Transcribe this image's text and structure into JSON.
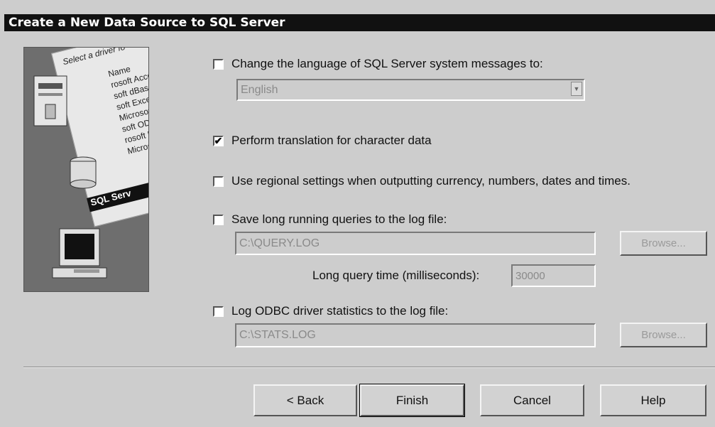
{
  "window": {
    "title": "Create a New Data Source to SQL Server"
  },
  "art": {
    "caption": "Select a driver fo",
    "list": [
      "Name",
      "rosoft Access D",
      "soft dBase D",
      "soft Excel D",
      "Microsoft FoxPr",
      "soft ODBC",
      "rosoft Para",
      "Microsoft Tex"
    ],
    "selected": "SQL Serv"
  },
  "options": {
    "language": {
      "checked": false,
      "mark": "",
      "label": "Change the language of SQL Server system messages to:",
      "value": "English"
    },
    "translation": {
      "checked": true,
      "mark": "✔",
      "label": "Perform translation for character data"
    },
    "regional": {
      "checked": false,
      "mark": "",
      "label": "Use regional settings when outputting currency, numbers, dates and times."
    },
    "long_queries": {
      "checked": false,
      "mark": "",
      "label": "Save long running queries to the log file:",
      "file": "C:\\QUERY.LOG",
      "browse_label": "Browse...",
      "time_label": "Long query time (milliseconds):",
      "time_value": "30000"
    },
    "stats": {
      "checked": false,
      "mark": "",
      "label": "Log ODBC driver statistics to the log file:",
      "file": "C:\\STATS.LOG",
      "browse_label": "Browse..."
    }
  },
  "buttons": {
    "back": "< Back",
    "finish": "Finish",
    "cancel": "Cancel",
    "help": "Help"
  },
  "icons": {
    "dropdown": "chevron-down-icon",
    "driver_art": "driver-illustration"
  }
}
